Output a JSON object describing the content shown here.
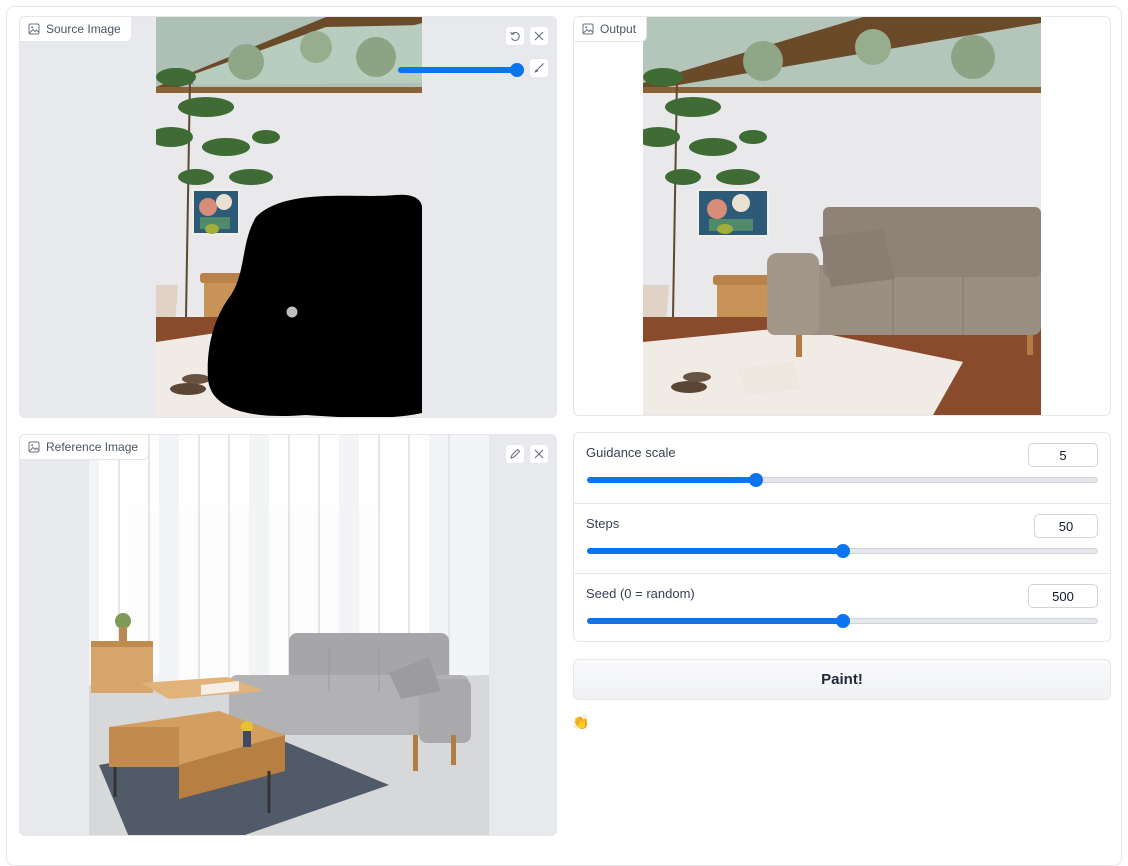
{
  "panels": {
    "source": {
      "label": "Source Image",
      "brush_size_fraction": 1.0
    },
    "output": {
      "label": "Output"
    },
    "reference": {
      "label": "Reference Image"
    }
  },
  "settings": [
    {
      "name": "Guidance scale",
      "value": "5",
      "fraction": 0.33
    },
    {
      "name": "Steps",
      "value": "50",
      "fraction": 0.5
    },
    {
      "name": "Seed (0 = random)",
      "value": "500",
      "fraction": 0.5
    }
  ],
  "paint_button": "Paint!",
  "status_emoji": "👏",
  "colors": {
    "accent": "#0b74f0",
    "panel_bg": "#e8e9ec",
    "mask": "#000000"
  },
  "icons": [
    "image-icon",
    "undo-icon",
    "close-icon",
    "brush-icon",
    "pencil-icon"
  ]
}
